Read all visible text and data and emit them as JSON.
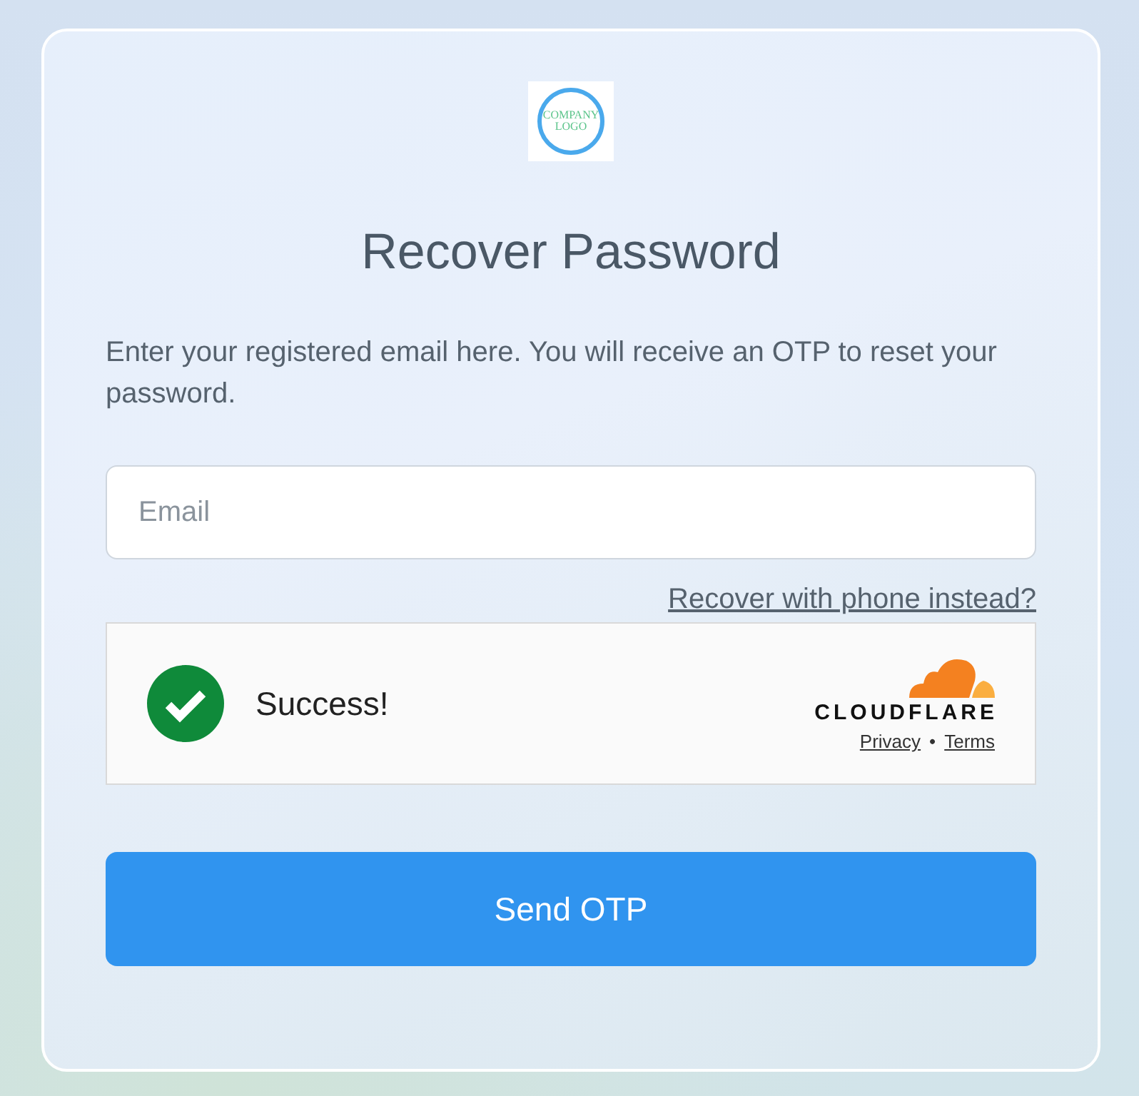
{
  "logo": {
    "text": "COMPANY LOGO"
  },
  "title": "Recover Password",
  "description": "Enter your registered email here. You will receive an OTP to reset your password.",
  "email_field": {
    "placeholder": "Email"
  },
  "alt_link": "Recover with phone instead?",
  "captcha": {
    "status": "Success!",
    "brand": "CLOUDFLARE",
    "links": [
      "Privacy",
      "Terms"
    ],
    "separator": "•"
  },
  "submit_button": "Send OTP"
}
